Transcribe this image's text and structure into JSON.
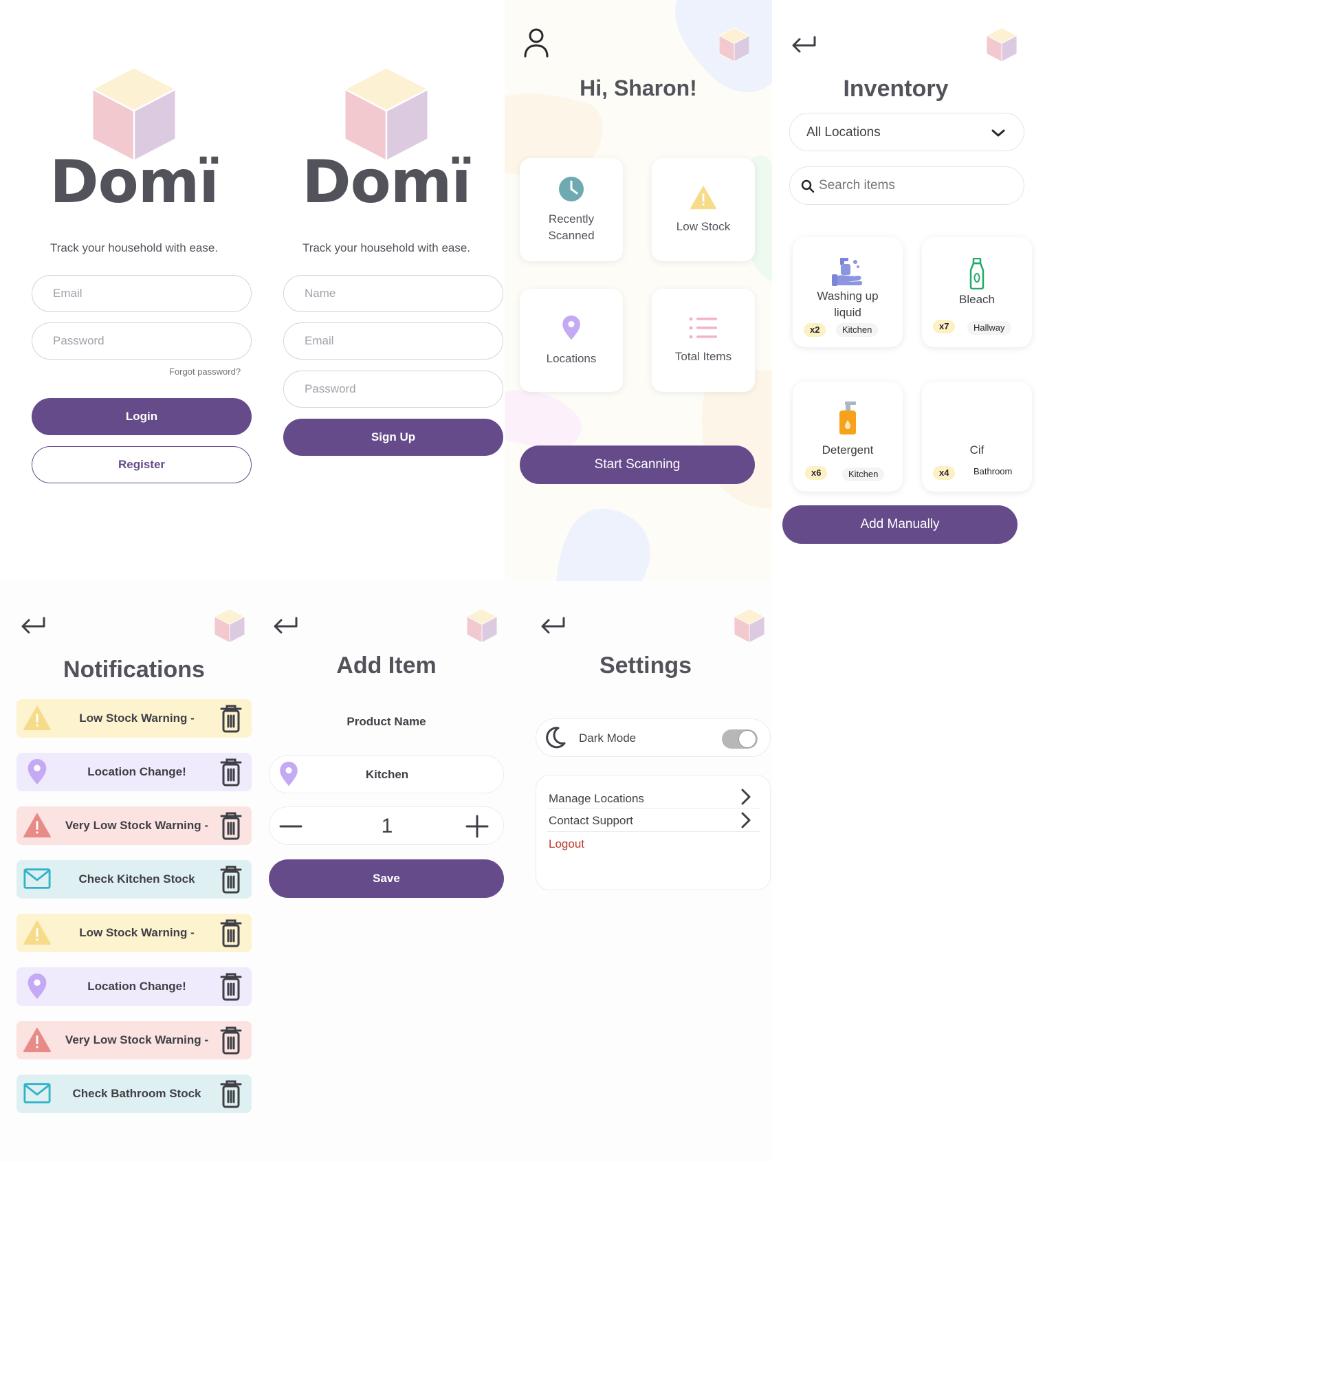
{
  "login": {
    "logo_text": "Domï",
    "tagline": "Track your household with ease.",
    "email_placeholder": "Email",
    "password_placeholder": "Password",
    "forgot_label": "Forgot password?",
    "login_label": "Login",
    "register_label": "Register"
  },
  "signup": {
    "logo_text": "Domï",
    "tagline": "Track your household with ease.",
    "name_placeholder": "Name",
    "email_placeholder": "Email",
    "password_placeholder": "Password",
    "signup_label": "Sign Up"
  },
  "home": {
    "greeting": "Hi, Sharon!",
    "cards": [
      {
        "label": "Recently Scanned",
        "icon": "clock-icon"
      },
      {
        "label": "Low Stock",
        "icon": "warning-icon"
      },
      {
        "label": "Locations",
        "icon": "location-pin-icon"
      },
      {
        "label": "Total Items",
        "icon": "list-icon"
      }
    ],
    "start_label": "Start Scanning"
  },
  "inventory": {
    "title": "Inventory",
    "location_select": "All Locations",
    "search_placeholder": "Search items",
    "items": [
      {
        "name": "Washing up liquid",
        "qty": "x2",
        "location": "Kitchen",
        "icon": "hand-wash-icon"
      },
      {
        "name": "Bleach",
        "qty": "x7",
        "location": "Hallway",
        "icon": "bottle-icon"
      },
      {
        "name": "Detergent",
        "qty": "x6",
        "location": "Kitchen",
        "icon": "soap-dispenser-icon"
      },
      {
        "name": "Cif",
        "qty": "x4",
        "location": "Bathroom",
        "icon": ""
      }
    ],
    "add_label": "Add Manually"
  },
  "notifications": {
    "title": "Notifications",
    "items": [
      {
        "text": "Low Stock Warning -",
        "type": "warning",
        "bg": "#fdf3cf"
      },
      {
        "text": "Location Change!",
        "type": "location",
        "bg": "#efeafc"
      },
      {
        "text": "Very Low Stock Warning -",
        "type": "danger",
        "bg": "#fbe3e1"
      },
      {
        "text": "Check Kitchen Stock",
        "type": "mail",
        "bg": "#dff0f2"
      },
      {
        "text": "Low Stock Warning -",
        "type": "warning",
        "bg": "#fdf3cf"
      },
      {
        "text": "Location Change!",
        "type": "location",
        "bg": "#efeafc"
      },
      {
        "text": "Very Low Stock Warning -",
        "type": "danger",
        "bg": "#fbe3e1"
      },
      {
        "text": "Check Bathroom Stock",
        "type": "mail",
        "bg": "#dff0f2"
      }
    ]
  },
  "add_item": {
    "title": "Add Item",
    "product_label": "Product Name",
    "location_value": "Kitchen",
    "quantity": "1",
    "save_label": "Save"
  },
  "settings": {
    "title": "Settings",
    "dark_mode_label": "Dark Mode",
    "manage_locations_label": "Manage Locations",
    "contact_support_label": "Contact Support",
    "logout_label": "Logout"
  },
  "colors": {
    "primary": "#654b8a",
    "logout": "#c0392b",
    "cube_top": "#fcf1d3",
    "cube_left": "#f1c9cf",
    "cube_right": "#dccbe0"
  }
}
